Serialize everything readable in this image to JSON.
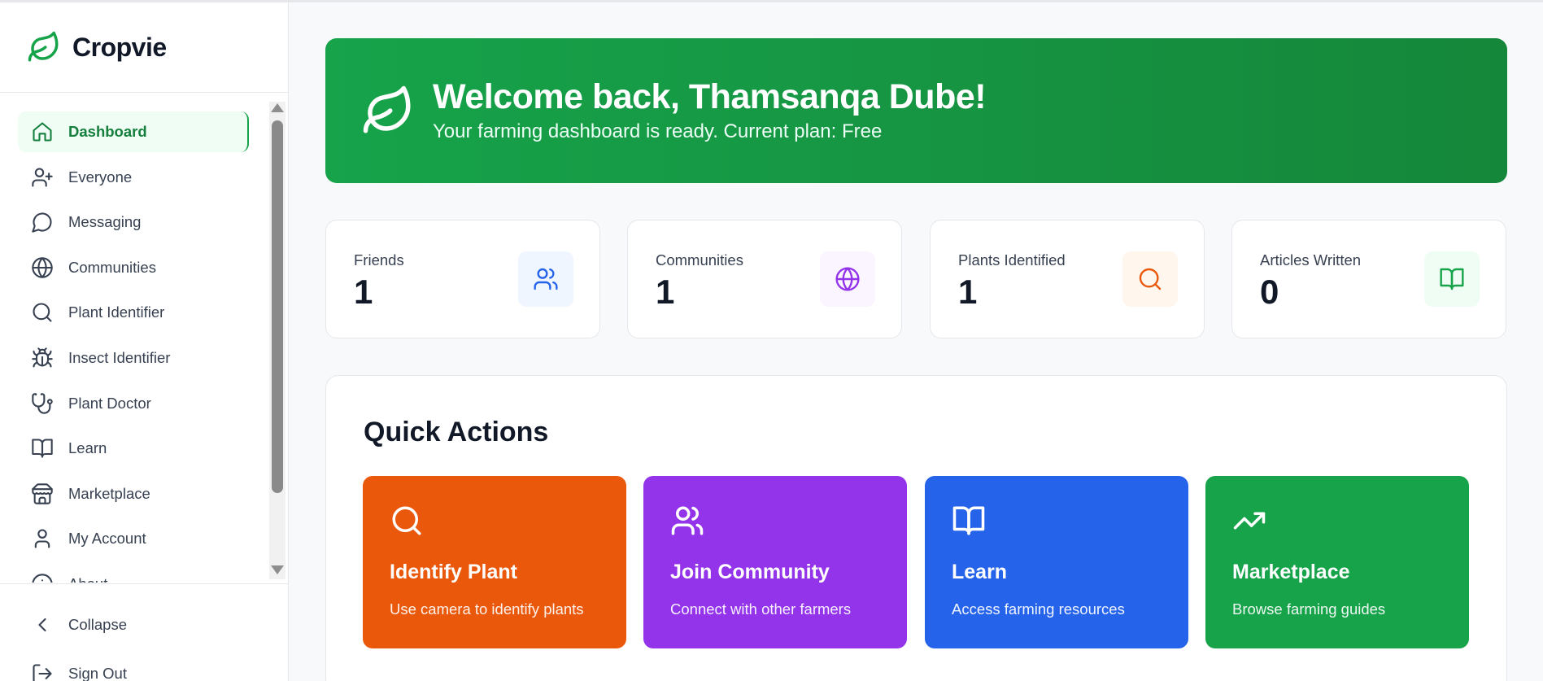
{
  "app": {
    "name": "Cropvie"
  },
  "colors": {
    "brand_green": "#16a34a",
    "orange": "#ea580c",
    "purple": "#9333ea",
    "blue": "#2563eb"
  },
  "sidebar": {
    "items": [
      {
        "label": "Dashboard",
        "icon": "home-icon",
        "active": true
      },
      {
        "label": "Everyone",
        "icon": "user-plus-icon"
      },
      {
        "label": "Messaging",
        "icon": "message-circle-icon"
      },
      {
        "label": "Communities",
        "icon": "globe-icon"
      },
      {
        "label": "Plant Identifier",
        "icon": "search-icon"
      },
      {
        "label": "Insect Identifier",
        "icon": "bug-icon"
      },
      {
        "label": "Plant Doctor",
        "icon": "stethoscope-icon"
      },
      {
        "label": "Learn",
        "icon": "book-open-icon"
      },
      {
        "label": "Marketplace",
        "icon": "store-icon"
      },
      {
        "label": "My Account",
        "icon": "user-icon"
      },
      {
        "label": "About",
        "icon": "info-icon"
      }
    ],
    "collapse_label": "Collapse",
    "signout_label": "Sign Out"
  },
  "hero": {
    "title": "Welcome back, Thamsanqa Dube!",
    "subtitle": "Your farming dashboard is ready. Current plan: Free"
  },
  "stats": [
    {
      "label": "Friends",
      "value": "1",
      "icon": "users-icon"
    },
    {
      "label": "Communities",
      "value": "1",
      "icon": "globe-icon"
    },
    {
      "label": "Plants Identified",
      "value": "1",
      "icon": "search-icon"
    },
    {
      "label": "Articles Written",
      "value": "0",
      "icon": "book-open-icon"
    }
  ],
  "quick_actions": {
    "title": "Quick Actions",
    "items": [
      {
        "title": "Identify Plant",
        "desc": "Use camera to identify plants",
        "icon": "search-icon"
      },
      {
        "title": "Join Community",
        "desc": "Connect with other farmers",
        "icon": "users-icon"
      },
      {
        "title": "Learn",
        "desc": "Access farming resources",
        "icon": "book-open-icon"
      },
      {
        "title": "Marketplace",
        "desc": "Browse farming guides",
        "icon": "trending-up-icon"
      }
    ]
  }
}
